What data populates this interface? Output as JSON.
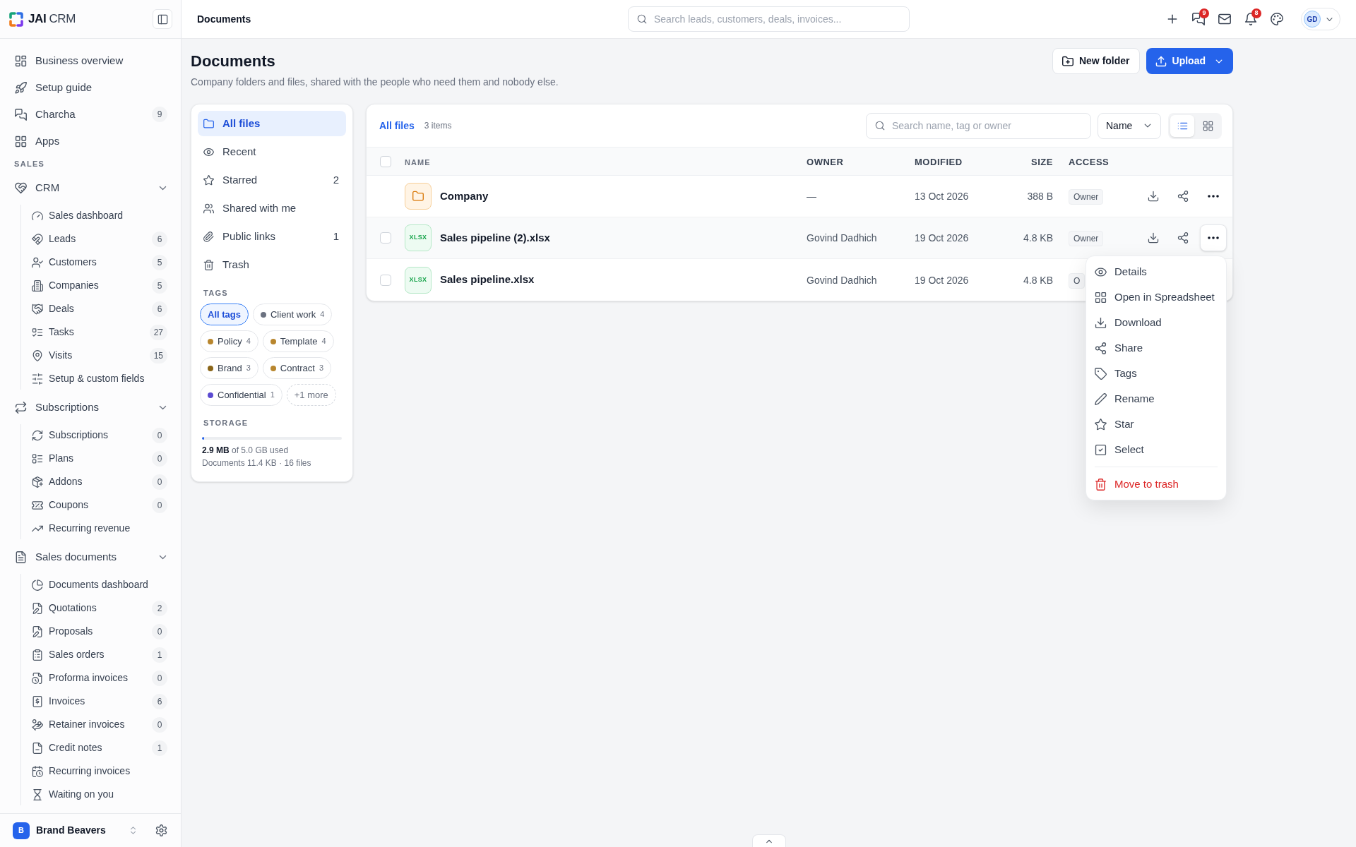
{
  "sidebar": {
    "brand": "**JAI** CRM",
    "top_items": [
      {
        "label": "Business overview"
      },
      {
        "label": "Setup guide"
      },
      {
        "label": "Charcha",
        "count": "9"
      },
      {
        "label": "Apps"
      }
    ],
    "section_label": "SALES",
    "groups": [
      {
        "label": "CRM",
        "expanded": true,
        "children": [
          {
            "label": "Sales dashboard"
          },
          {
            "label": "Leads",
            "count": "6"
          },
          {
            "label": "Customers",
            "count": "5"
          },
          {
            "label": "Companies",
            "count": "5"
          },
          {
            "label": "Deals",
            "count": "6"
          },
          {
            "label": "Tasks",
            "count": "27"
          },
          {
            "label": "Visits",
            "count": "15"
          },
          {
            "label": "Setup & custom fields"
          }
        ]
      },
      {
        "label": "Subscriptions",
        "expanded": true,
        "children": [
          {
            "label": "Subscriptions",
            "count": "0"
          },
          {
            "label": "Plans",
            "count": "0"
          },
          {
            "label": "Addons",
            "count": "0"
          },
          {
            "label": "Coupons",
            "count": "0"
          },
          {
            "label": "Recurring revenue"
          }
        ]
      },
      {
        "label": "Sales documents",
        "expanded": true,
        "children": [
          {
            "label": "Documents dashboard"
          },
          {
            "label": "Quotations",
            "count": "2"
          },
          {
            "label": "Proposals",
            "count": "0"
          },
          {
            "label": "Sales orders",
            "count": "1"
          },
          {
            "label": "Proforma invoices",
            "count": "0"
          },
          {
            "label": "Invoices",
            "count": "6"
          },
          {
            "label": "Retainer invoices",
            "count": "0"
          },
          {
            "label": "Credit notes",
            "count": "1"
          },
          {
            "label": "Recurring invoices"
          },
          {
            "label": "Waiting on you"
          }
        ]
      }
    ],
    "workspace": {
      "initial": "B",
      "name": "Brand Beavers"
    }
  },
  "header": {
    "title": "Documents",
    "search": {
      "placeholder": "Search leads, customers, deals, invoices..."
    },
    "chat_badge": "9",
    "notification_badge": "8",
    "avatar_initials": "GD"
  },
  "page": {
    "title": "Documents",
    "subtitle": "Company folders and files, shared with the people who need them and nobody else.",
    "actions": [
      {
        "label": "New folder",
        "kind": "secondary"
      },
      {
        "label": "Upload",
        "kind": "primary"
      }
    ]
  },
  "library": {
    "nav": [
      {
        "label": "All files",
        "selected": true
      },
      {
        "label": "Recent",
        "selected": false
      },
      {
        "label": "Starred",
        "count": "2",
        "selected": false
      },
      {
        "label": "Shared with me",
        "selected": false
      },
      {
        "label": "Public links",
        "count": "1",
        "selected": false
      },
      {
        "label": "Trash",
        "selected": false
      }
    ],
    "tags_label": "TAGS",
    "tags": [
      {
        "kind": "all",
        "label": "All tags",
        "selected": true
      },
      {
        "kind": "tag",
        "label": "Client work",
        "count": "4",
        "color": "#6b7280",
        "selected": false
      },
      {
        "kind": "tag",
        "label": "Policy",
        "count": "4",
        "color": "#b8862e",
        "selected": false
      },
      {
        "kind": "tag",
        "label": "Template",
        "count": "4",
        "color": "#b8862e",
        "selected": false
      },
      {
        "kind": "tag",
        "label": "Brand",
        "count": "3",
        "color": "#8a6518",
        "selected": false
      },
      {
        "kind": "tag",
        "label": "Contract",
        "count": "3",
        "color": "#b8862e",
        "selected": false
      },
      {
        "kind": "tag",
        "label": "Confidential",
        "count": "1",
        "color": "#5b4bd1",
        "selected": false
      },
      {
        "kind": "more",
        "label": "+1 more",
        "selected": false
      }
    ],
    "storage_label": "STORAGE",
    "storage": {
      "level": 0.015,
      "usage": "**2.9 MB** of 5.0 GB used",
      "breakdown": "Documents 11.4 KB · 16 files"
    }
  },
  "table": {
    "breadcrumb": "All files",
    "item_count": "3 items",
    "search": {
      "placeholder": "Search name, tag or owner"
    },
    "sort": {
      "value": "Name"
    },
    "view_modes": [
      {
        "selected": true
      },
      {
        "selected": false
      }
    ],
    "select_all": {
      "checked": false
    },
    "columns": [
      "NAME",
      "OWNER",
      "MODIFIED",
      "SIZE",
      "ACCESS"
    ],
    "rows": [
      {
        "kind": "folder",
        "name": "Company",
        "owner": "—",
        "modified": "13 Oct 2026",
        "size": "388 B",
        "access": "Owner",
        "menu_open": false
      },
      {
        "kind": "file",
        "type_label": "XLSX",
        "name": "Sales pipeline (2).xlsx",
        "owner": "Govind Dadhich",
        "modified": "19 Oct 2026",
        "size": "4.8 KB",
        "access": "Owner",
        "checked": false,
        "menu_open": true
      },
      {
        "kind": "file",
        "type_label": "XLSX",
        "name": "Sales pipeline.xlsx",
        "owner": "Govind Dadhich",
        "modified": "19 Oct 2026",
        "size": "4.8 KB",
        "access": "O",
        "checked": false
      }
    ]
  },
  "context_menu": {
    "items": [
      {
        "label": "Details",
        "kind": "normal"
      },
      {
        "label": "Open in Spreadsheet",
        "kind": "normal"
      },
      {
        "label": "Download",
        "kind": "normal"
      },
      {
        "label": "Share",
        "kind": "normal"
      },
      {
        "label": "Tags",
        "kind": "normal"
      },
      {
        "label": "Rename",
        "kind": "normal"
      },
      {
        "label": "Star",
        "kind": "normal"
      },
      {
        "label": "Select",
        "kind": "normal"
      },
      {
        "label": "Move to trash",
        "kind": "danger"
      }
    ]
  }
}
